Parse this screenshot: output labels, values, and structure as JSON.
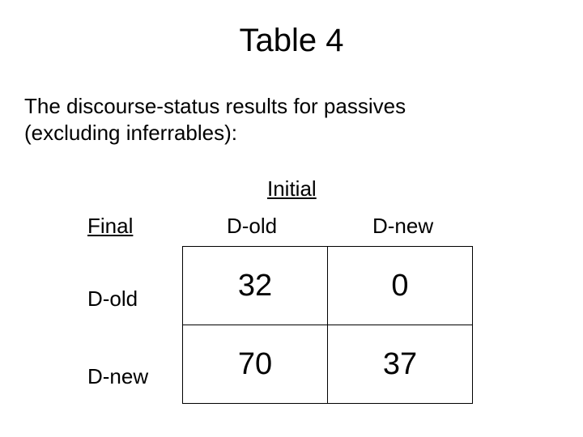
{
  "title": "Table 4",
  "caption_line1": "The discourse-status results for passives",
  "caption_line2": "(excluding inferrables):",
  "labels": {
    "initial": "Initial",
    "final": "Final",
    "col_dold": "D-old",
    "col_dnew": "D-new",
    "row_dold": "D-old",
    "row_dnew": "D-new"
  },
  "chart_data": {
    "type": "table",
    "title": "Table 4 — discourse-status results for passives (excluding inferrables)",
    "row_dimension": "Final",
    "col_dimension": "Initial",
    "rows": [
      "D-old",
      "D-new"
    ],
    "cols": [
      "D-old",
      "D-new"
    ],
    "values": [
      [
        32,
        0
      ],
      [
        70,
        37
      ]
    ]
  }
}
